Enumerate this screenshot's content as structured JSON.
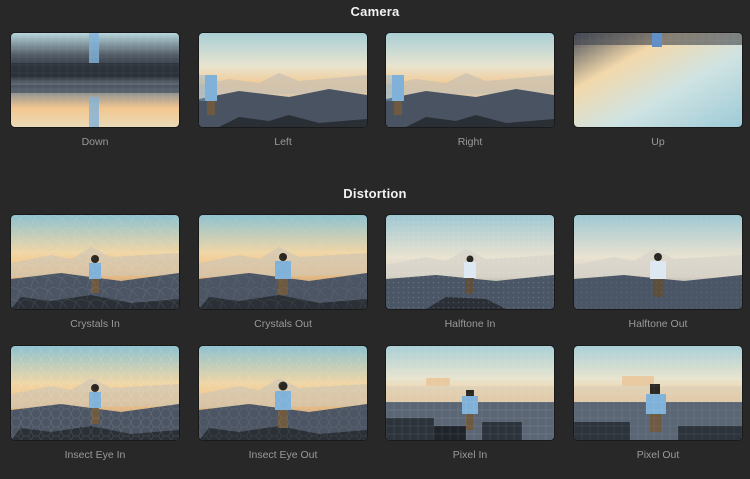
{
  "sections": [
    {
      "title": "Camera"
    },
    {
      "title": "Distortion"
    }
  ],
  "camera_items": [
    {
      "label": "Down"
    },
    {
      "label": "Left"
    },
    {
      "label": "Right"
    },
    {
      "label": "Up"
    }
  ],
  "distortion_items": [
    {
      "label": "Crystals In"
    },
    {
      "label": "Crystals Out"
    },
    {
      "label": "Halftone In"
    },
    {
      "label": "Halftone Out"
    },
    {
      "label": "Insect Eye In"
    },
    {
      "label": "Insect Eye Out"
    },
    {
      "label": "Pixel In"
    },
    {
      "label": "Pixel Out"
    }
  ]
}
